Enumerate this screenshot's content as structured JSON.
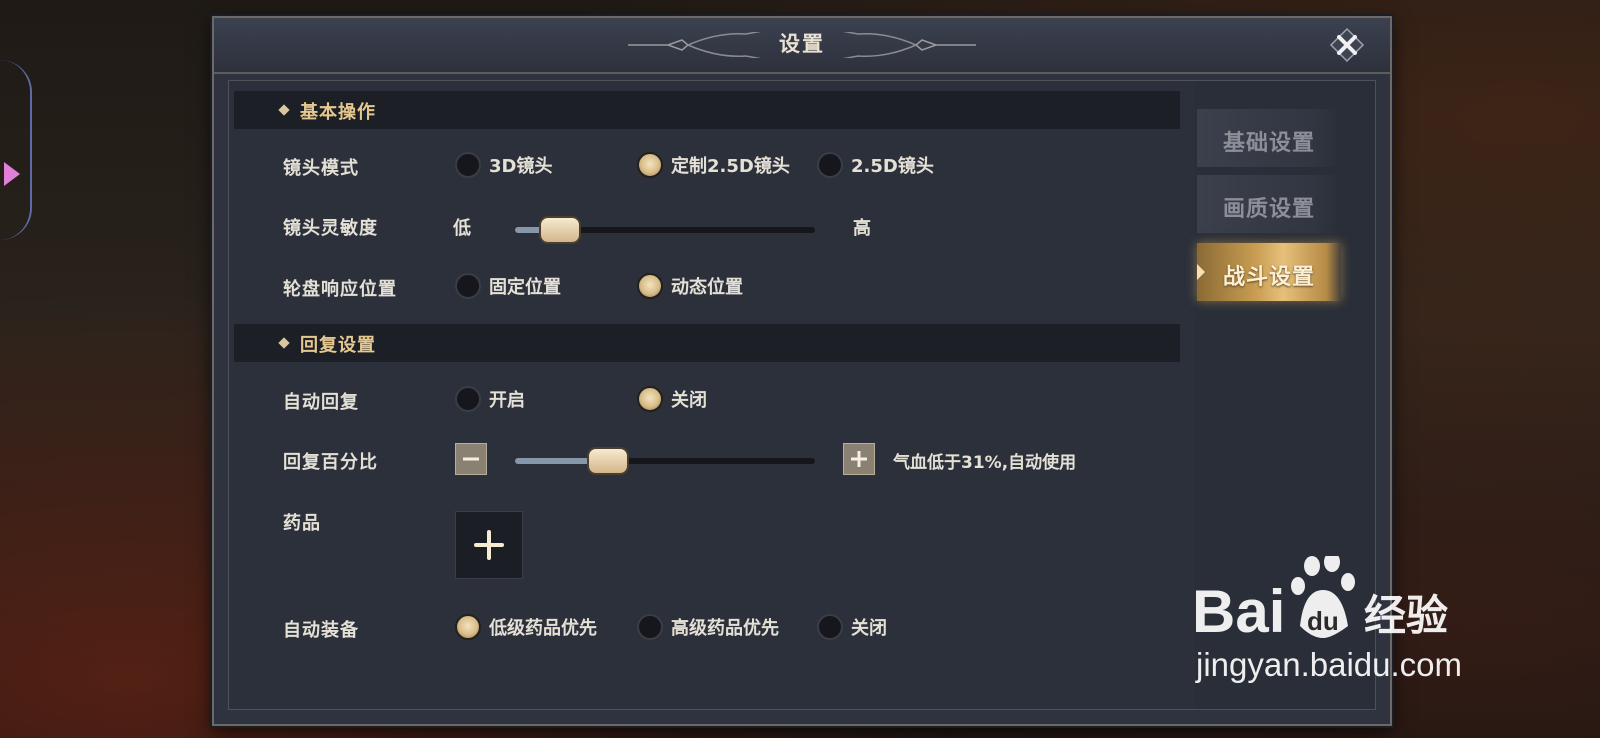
{
  "dialog": {
    "title": "设置"
  },
  "sections": {
    "basic": {
      "title": "基本操作",
      "camera_mode": {
        "label": "镜头模式",
        "options": [
          "3D镜头",
          "定制2.5D镜头",
          "2.5D镜头"
        ],
        "selected": "定制2.5D镜头"
      },
      "camera_sensitivity": {
        "label": "镜头灵敏度",
        "low": "低",
        "high": "高",
        "value": 0.15
      },
      "wheel_position": {
        "label": "轮盘响应位置",
        "options": [
          "固定位置",
          "动态位置"
        ],
        "selected": "动态位置"
      }
    },
    "recovery": {
      "title": "回复设置",
      "auto_recover": {
        "label": "自动回复",
        "options": [
          "开启",
          "关闭"
        ],
        "selected": "关闭"
      },
      "recover_percent": {
        "label": "回复百分比",
        "status": "气血低于31%,自动使用",
        "value": 0.31
      },
      "potion": {
        "label": "药品"
      },
      "auto_equip": {
        "label": "自动装备",
        "options": [
          "低级药品优先",
          "高级药品优先",
          "关闭"
        ],
        "selected": "低级药品优先"
      }
    }
  },
  "tabs": [
    {
      "label": "基础设置",
      "active": false
    },
    {
      "label": "画质设置",
      "active": false
    },
    {
      "label": "战斗设置",
      "active": true
    }
  ],
  "watermark": {
    "brand_left": "Bai",
    "brand_right": "经验",
    "brand_paw_text": "du",
    "url": "jingyan.baidu.com"
  },
  "icons": {
    "close": "close-x-icon",
    "minus": "minus-icon",
    "plus": "plus-icon",
    "add_potion": "plus-icon"
  },
  "colors": {
    "accent_gold": "#e5c88f",
    "panel_bg": "#2b303b",
    "active_tab": "#c79c52"
  }
}
